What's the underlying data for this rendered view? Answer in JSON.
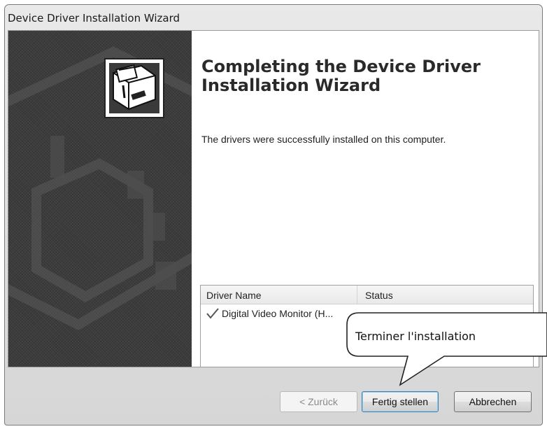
{
  "window": {
    "title": "Device Driver Installation Wizard"
  },
  "wizard": {
    "heading": "Completing the Device Driver Installation Wizard",
    "message": "The drivers were successfully installed on this computer.",
    "icon": "driver-install-box-icon"
  },
  "driver_table": {
    "columns": [
      "Driver Name",
      "Status"
    ],
    "rows": [
      {
        "name": "Digital Video Monitor (H...",
        "status": "",
        "icon": "check-icon"
      }
    ]
  },
  "buttons": {
    "back": "< Zurück",
    "finish": "Fertig stellen",
    "cancel": "Abbrechen"
  },
  "callout": {
    "text": "Terminer l'installation"
  }
}
